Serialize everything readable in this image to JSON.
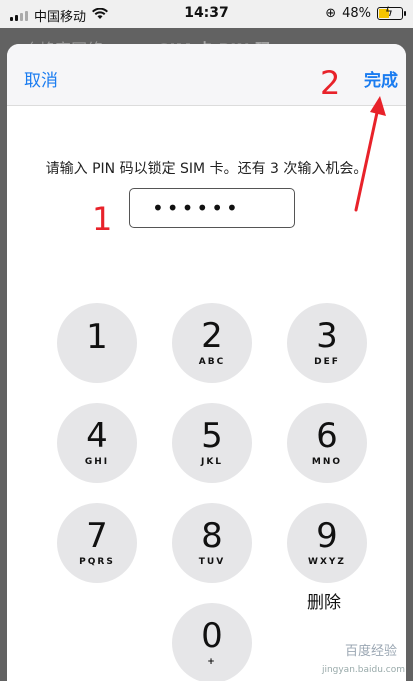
{
  "status_bar": {
    "carrier": "中国移动",
    "time": "14:37",
    "battery_percent": "48%"
  },
  "background_nav": {
    "back_label": "〈 蜂窝网络",
    "title": "SIM 卡 PIN 码"
  },
  "sheet": {
    "cancel_label": "取消",
    "done_label": "完成",
    "prompt": "请输入 PIN 码以锁定 SIM 卡。还有 3 次输入机会。",
    "pin_value": "••••••"
  },
  "keypad": {
    "keys": [
      {
        "digit": "1",
        "letters": ""
      },
      {
        "digit": "2",
        "letters": "ABC"
      },
      {
        "digit": "3",
        "letters": "DEF"
      },
      {
        "digit": "4",
        "letters": "GHI"
      },
      {
        "digit": "5",
        "letters": "JKL"
      },
      {
        "digit": "6",
        "letters": "MNO"
      },
      {
        "digit": "7",
        "letters": "PQRS"
      },
      {
        "digit": "8",
        "letters": "TUV"
      },
      {
        "digit": "9",
        "letters": "WXYZ"
      },
      {
        "digit": "0",
        "letters": "+"
      }
    ],
    "delete_label": "删除"
  },
  "annotations": {
    "step1": "1",
    "step2": "2",
    "color": "#e8222a"
  },
  "watermark": {
    "title": "百度经验",
    "url": "jingyan.baidu.com"
  },
  "colors": {
    "accent": "#1a7cf0",
    "key_bg": "#e6e6e8",
    "battery": "#f5c400"
  }
}
